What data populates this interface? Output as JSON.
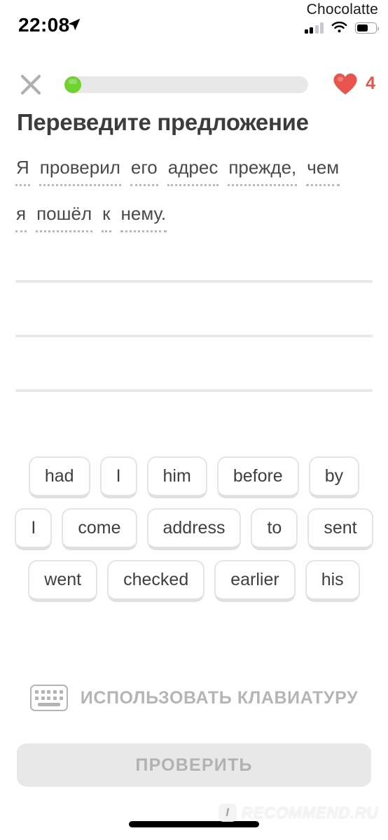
{
  "status_bar": {
    "carrier": "Chocolatte",
    "time": "22:08",
    "location_icon": "location-arrow-icon",
    "signal_icon": "cellular-signal-icon",
    "signal_bars_filled": 2,
    "signal_bars_total": 4,
    "wifi_icon": "wifi-icon",
    "battery_icon": "battery-icon",
    "battery_percent": 60
  },
  "header": {
    "close_icon": "close-x-icon",
    "progress_percent": 7,
    "progress_fill_color": "#6fd22e",
    "progress_track_color": "#e8e8e8",
    "heart_icon": "heart-icon",
    "heart_color": "#e8554e",
    "hearts_count": "4"
  },
  "prompt": {
    "title": "Переведите предложение",
    "sentence_lines": [
      [
        "Я",
        "проверил",
        "его",
        "адрес",
        "прежде,",
        "чем"
      ],
      [
        "я",
        "пошёл",
        "к",
        "нему."
      ]
    ]
  },
  "answer": {
    "lines": [
      "",
      "",
      ""
    ]
  },
  "word_bank": {
    "rows": [
      [
        "had",
        "I",
        "him",
        "before",
        "by"
      ],
      [
        "I",
        "come",
        "address",
        "to",
        "sent"
      ],
      [
        "went",
        "checked",
        "earlier",
        "his"
      ]
    ]
  },
  "keyboard_toggle": {
    "icon": "keyboard-icon",
    "label": "ИСПОЛЬЗОВАТЬ КЛАВИАТУРУ"
  },
  "check_button": {
    "label": "ПРОВЕРИТЬ",
    "disabled": true,
    "background": "#e8e8e8",
    "text_color": "#b2b2b2"
  },
  "watermark": {
    "badge": "I",
    "text": "RECOMMEND.RU"
  }
}
